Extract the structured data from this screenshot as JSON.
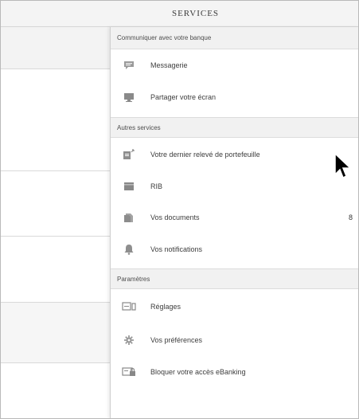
{
  "header": {
    "title": "SERVICES"
  },
  "menu": {
    "sections": [
      {
        "label": "Communiquer avec votre banque",
        "items": [
          {
            "label": "Messagerie",
            "icon": "chat-icon"
          },
          {
            "label": "Partager votre écran",
            "icon": "screen-share-icon"
          }
        ]
      },
      {
        "label": "Autres services",
        "items": [
          {
            "label": "Votre dernier relevé de portefeuille",
            "icon": "statement-icon"
          },
          {
            "label": "RIB",
            "icon": "card-icon"
          },
          {
            "label": "Vos documents",
            "icon": "documents-icon",
            "badge": "8"
          },
          {
            "label": "Vos notifications",
            "icon": "bell-icon"
          }
        ]
      },
      {
        "label": "Paramètres",
        "items": [
          {
            "label": "Réglages",
            "icon": "settings-panel-icon"
          },
          {
            "label": "Vos préférences",
            "icon": "gear-icon"
          },
          {
            "label": "Bloquer votre accès eBanking",
            "icon": "lock-access-icon"
          }
        ]
      }
    ]
  },
  "colors": {
    "icon": "#8e8e8e",
    "section_bg": "#f1f1f1",
    "header_bg": "#f4f4f4"
  }
}
